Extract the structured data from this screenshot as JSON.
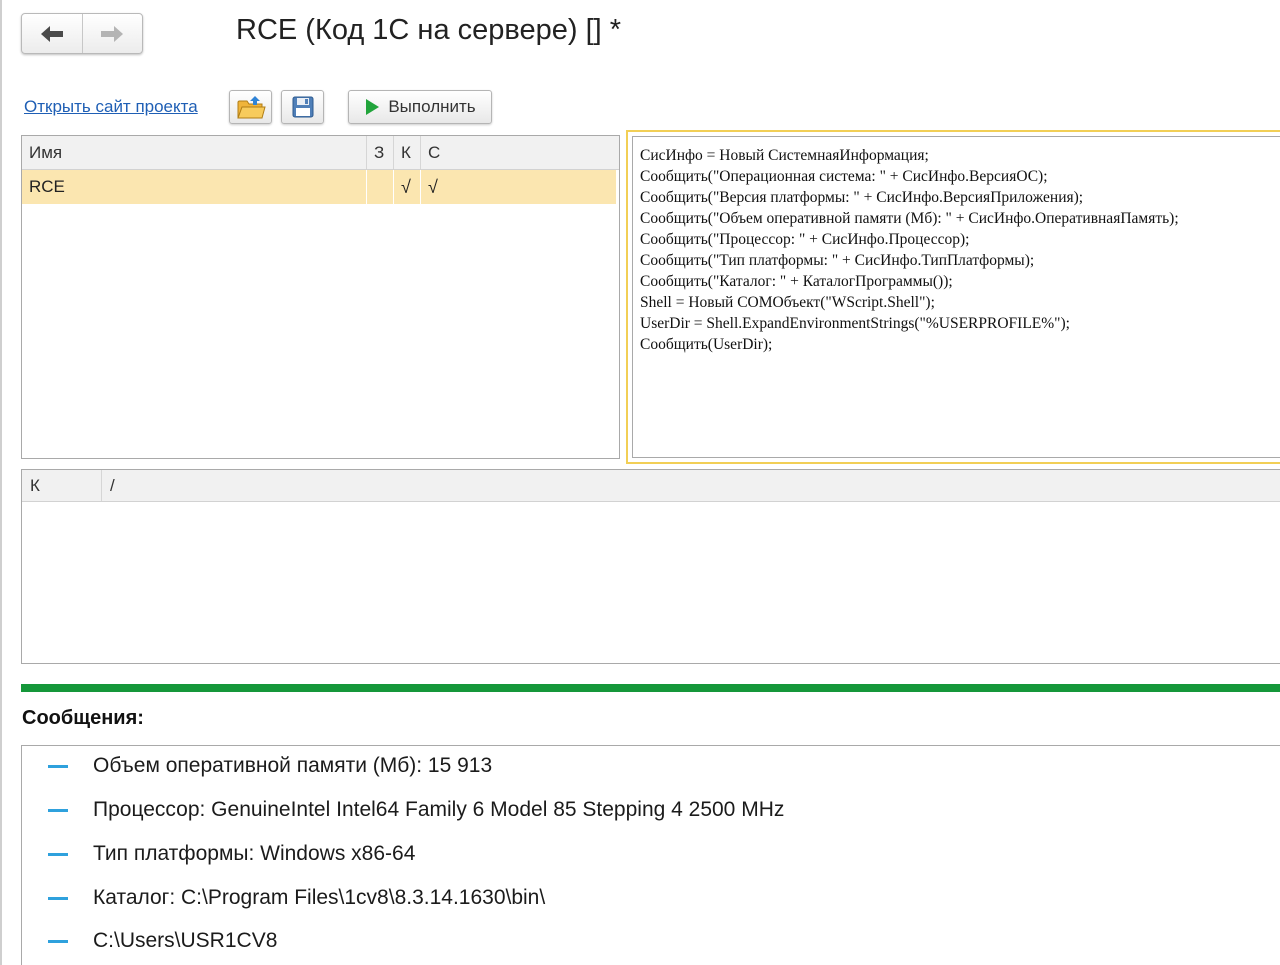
{
  "window": {
    "title": "RCE (Код 1С на сервере) [] *"
  },
  "toolbar": {
    "project_link": "Открыть сайт проекта",
    "run_label": "Выполнить"
  },
  "scripts_table": {
    "columns": [
      "Имя",
      "З",
      "К",
      "С"
    ],
    "rows": [
      {
        "name": "RCE",
        "z": "",
        "k": "√",
        "s": "√"
      }
    ]
  },
  "code": {
    "lines": [
      "СисИнфо = Новый СистемнаяИнформация;",
      "Сообщить(\"Операционная система: \" + СисИнфо.ВерсияОС);",
      "Сообщить(\"Версия платформы: \" + СисИнфо.ВерсияПриложения);",
      "Сообщить(\"Объем оперативной памяти (Мб): \" + СисИнфо.ОперативнаяПамять);",
      "Сообщить(\"Процессор: \" + СисИнфо.Процессор);",
      "Сообщить(\"Тип платформы: \" + СисИнфо.ТипПлатформы);",
      "Сообщить(\"Каталог: \" + КаталогПрограммы());",
      "Shell = Новый COMОбъект(\"WScript.Shell\");",
      "UserDir = Shell.ExpandEnvironmentStrings(\"%USERPROFILE%\");",
      "Сообщить(UserDir);"
    ]
  },
  "params_table": {
    "columns": [
      "К",
      "/"
    ]
  },
  "messages": {
    "title": "Сообщения:",
    "items": [
      "Объем оперативной памяти (Мб): 15 913",
      "Процессор: GenuineIntel Intel64 Family 6 Model 85 Stepping 4 2500 MHz",
      "Тип платформы: Windows x86-64",
      "Каталог: C:\\Program Files\\1cv8\\8.3.14.1630\\bin\\",
      "C:\\Users\\USR1CV8"
    ]
  },
  "colors": {
    "accent_green": "#15973a",
    "selected_row": "#fbe6b0",
    "focus_border": "#f2cf56",
    "link": "#1f5fb5",
    "message_marker": "#2fa1dd"
  }
}
